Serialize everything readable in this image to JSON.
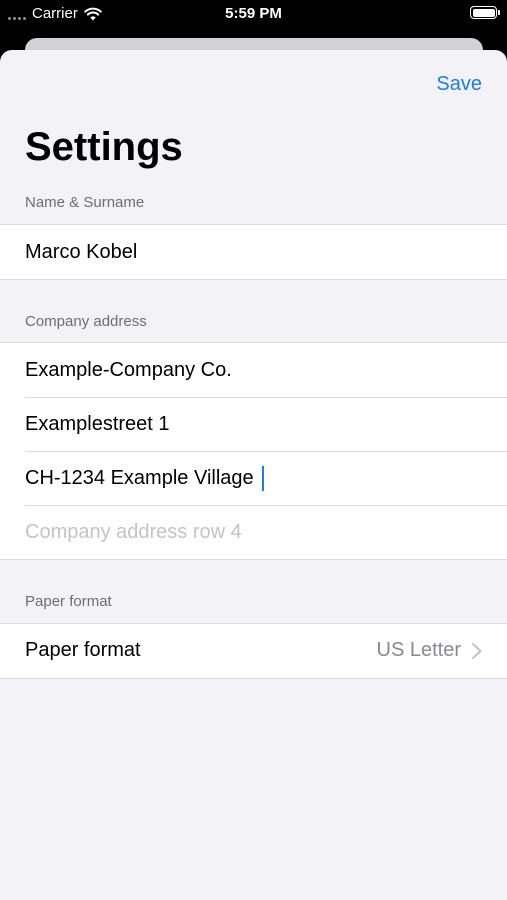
{
  "status_bar": {
    "carrier": "Carrier",
    "time": "5:59 PM"
  },
  "nav": {
    "save_label": "Save",
    "title": "Settings"
  },
  "sections": {
    "name": {
      "header": "Name & Surname",
      "value": "Marco Kobel"
    },
    "company": {
      "header": "Company address",
      "rows": [
        {
          "value": "Example-Company Co.",
          "placeholder": ""
        },
        {
          "value": "Examplestreet 1",
          "placeholder": ""
        },
        {
          "value": "CH-1234 Example Village",
          "placeholder": ""
        },
        {
          "value": "",
          "placeholder": "Company address row 4"
        }
      ]
    },
    "paper": {
      "header": "Paper format",
      "label": "Paper format",
      "value": "US Letter"
    }
  },
  "colors": {
    "accent": "#1a7ee8",
    "background": "#f2f2f7",
    "secondary_text": "#6d6d72",
    "placeholder": "#c4c4c8"
  },
  "icons": [
    "wifi-icon",
    "battery-icon",
    "chevron-right-icon"
  ]
}
